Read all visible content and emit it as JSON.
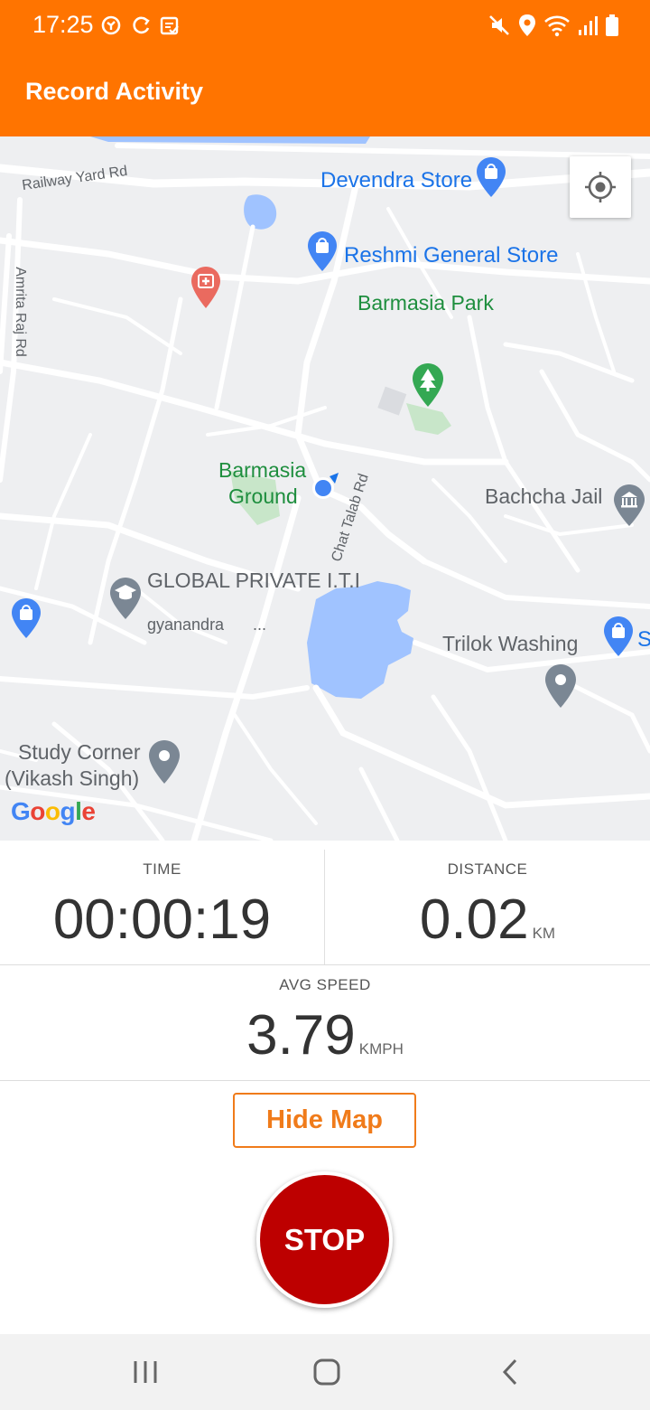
{
  "status_bar": {
    "time": "17:25",
    "icons_left": [
      "sync-alt-icon",
      "refresh-icon",
      "clipboard-icon"
    ],
    "icons_right": [
      "mute-icon",
      "location-icon",
      "wifi-icon",
      "signal-icon",
      "battery-icon"
    ]
  },
  "app": {
    "title": "Record Activity",
    "accent": "#ff7400"
  },
  "map": {
    "labels": {
      "devendra_store": "Devendra Store",
      "reshmi_general_store": "Reshmi General Store",
      "barmasia_park": "Barmasia Park",
      "railway_yard_rd": "Railway Yard Rd",
      "amrita_raj_rd": "Amrita Raj Rd",
      "barmasia_ground_1": "Barmasia",
      "barmasia_ground_2": "Ground",
      "chat_talab_rd": "Chat Talab Rd",
      "bachcha_jail": "Bachcha Jail",
      "global_private_iti": "GLOBAL PRIVATE I.T.I",
      "gyanandra": "gyanandra",
      "ellipsis": "...",
      "trilok_washing": "Trilok Washing",
      "s_partial": "S",
      "study_corner_1": "Study Corner",
      "study_corner_2": "(Vikash Singh)"
    },
    "attribution": {
      "g1": "G",
      "o1": "o",
      "o2": "o",
      "g2": "g",
      "l": "l",
      "e": "e"
    },
    "colors": {
      "water": "#a0c3ff",
      "park": "#c8e6c9",
      "road": "#ffffff",
      "background": "#eeeff1"
    }
  },
  "stats": {
    "time_label": "TIME",
    "time_value": "00:00:19",
    "distance_label": "DISTANCE",
    "distance_value": "0.02",
    "distance_unit": "KM",
    "speed_label": "AVG SPEED",
    "speed_value": "3.79",
    "speed_unit": "KMPH"
  },
  "buttons": {
    "hide_map": "Hide Map",
    "stop": "STOP",
    "stop_color": "#bd0000"
  },
  "nav_bar": {
    "items": [
      "recents-icon",
      "home-icon",
      "back-icon"
    ]
  }
}
